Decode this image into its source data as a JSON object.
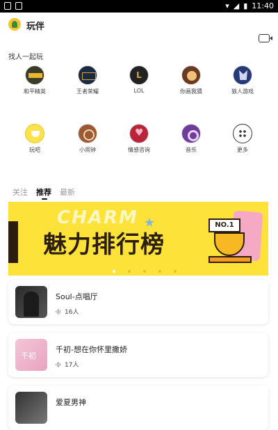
{
  "status_bar": {
    "time": "11:40"
  },
  "header": {
    "app_name": "玩伴"
  },
  "section": {
    "find_people": "找人一起玩"
  },
  "games_row1": [
    {
      "label": "和平精英",
      "icon": "pubg-icon"
    },
    {
      "label": "王者荣耀",
      "icon": "kog-icon"
    },
    {
      "label": "LOL",
      "icon": "lol-icon"
    },
    {
      "label": "你画我猜",
      "icon": "draw-guess-icon"
    },
    {
      "label": "狼人游戏",
      "icon": "werewolf-icon"
    }
  ],
  "games_row2": [
    {
      "label": "玩吧",
      "icon": "play-icon"
    },
    {
      "label": "小闹钟",
      "icon": "alarm-icon"
    },
    {
      "label": "情感咨询",
      "icon": "emotion-icon"
    },
    {
      "label": "音乐",
      "icon": "music-icon"
    },
    {
      "label": "更多",
      "icon": "more-icon"
    }
  ],
  "tabs": [
    {
      "label": "关注",
      "active": false
    },
    {
      "label": "推荐",
      "active": true
    },
    {
      "label": "最新",
      "active": false
    }
  ],
  "banner": {
    "title": "魅力排行榜",
    "charm_text": "CHARM",
    "badge": "NO.1",
    "dot_count": 5,
    "active_dot": 0
  },
  "rooms": [
    {
      "name": "Soul-点唱厅",
      "count": "16人"
    },
    {
      "name": "千初-想在你怀里撒娇",
      "count": "17人"
    },
    {
      "name": "爱夏男神",
      "count": ""
    }
  ],
  "colors": {
    "banner_bg": "#fde23a",
    "text_dark": "#2b1e10"
  }
}
